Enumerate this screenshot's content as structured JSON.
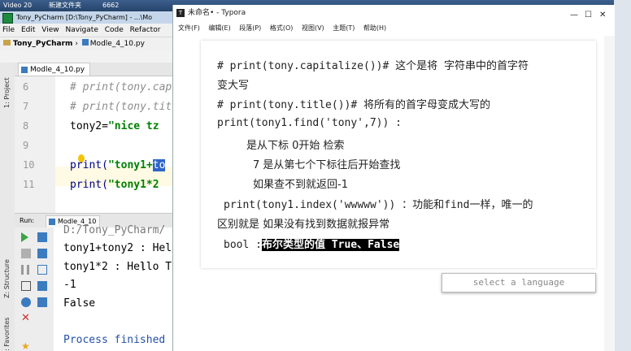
{
  "desktop": {
    "items": [
      "Video 20",
      "新建文件夹",
      "6662"
    ]
  },
  "pycharm": {
    "title": "Tony_PyCharm [D:\\Tony_PyCharm] - ...\\Mo",
    "menu": [
      "File",
      "Edit",
      "View",
      "Navigate",
      "Code",
      "Refactor"
    ],
    "nav_project": "Tony_PyCharm",
    "nav_file": "Modle_4_10.py",
    "editor_tab": "Modle_4_10.py",
    "left_tabs": [
      "1: Project",
      "Z: Structure",
      "2: Favorites"
    ],
    "line_numbers": [
      "6",
      "7",
      "8",
      "9",
      "10",
      "11"
    ],
    "code": {
      "l6": "# print(tony.cap",
      "l7": "# print(tony.tit",
      "l8_a": "tony2=",
      "l8_b": "\"nice tz",
      "l10_a": "print(",
      "l10_b": "\"tony1+",
      "l10_c": "to",
      "l11_a": "print(",
      "l11_b": "\"tony1*2"
    },
    "run_label": "Run:",
    "run_tab": "Modle_4_10",
    "console": [
      "D:/Tony_PyCharm/",
      "tony1+tony2 : Hel",
      "tony1*2 : Hello T",
      "-1",
      "False",
      "Process finished "
    ]
  },
  "typora": {
    "title": "未命名• - Typora",
    "menu": [
      "文件(F)",
      "编辑(E)",
      "段落(P)",
      "格式(O)",
      "视图(V)",
      "主题(T)",
      "帮助(H)"
    ],
    "lines": {
      "l1": "# print(tony.capitalize())# 这个是将 字符串中的首字符",
      "l2": "变大写",
      "l3": "# print(tony.title())# 将所有的首字母变成大写的",
      "l4": "print(tony1.find('tony',7))  :",
      "l5": "是从下标 0开始 检索",
      "l6": "7 是从第七个下标往后开始查找",
      "l7": "如果查不到就返回-1",
      "l8": "print(tony1.index('wwwww')) ：功能和find一样，唯一的",
      "l9": "区别就是 如果没有找到数据就报异常",
      "l10_a": "bool :",
      "l10_b": "布尔类型的值  True、False"
    },
    "language_placeholder": "select a language"
  }
}
